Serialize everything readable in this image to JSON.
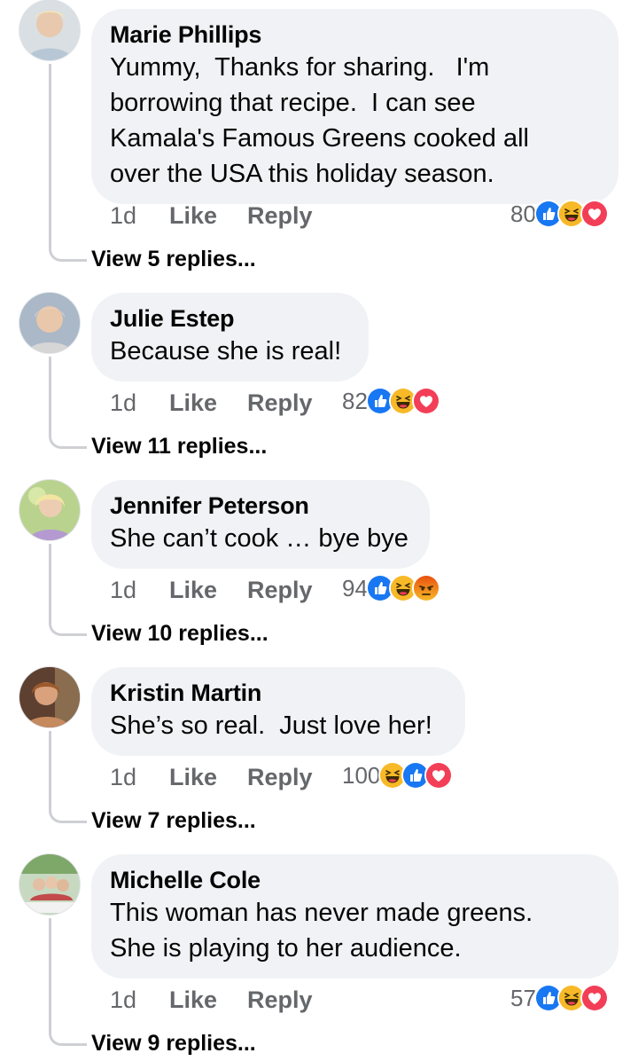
{
  "actions": {
    "like_label": "Like",
    "reply_label": "Reply"
  },
  "comments": [
    {
      "author": "Marie Phillips",
      "text": "Yummy,  Thanks for sharing.   I'm\nborrowing that recipe.  I can see\nKamala's Famous Greens cooked all\nover the USA this holiday season.",
      "time": "1d",
      "reaction_count": "80",
      "reactions": [
        "like-icon",
        "haha-icon",
        "love-icon"
      ],
      "view_replies": "View 5 replies..."
    },
    {
      "author": "Julie Estep",
      "text": "Because she is real!",
      "time": "1d",
      "reaction_count": "82",
      "reactions": [
        "like-icon",
        "haha-icon",
        "love-icon"
      ],
      "view_replies": "View 11 replies..."
    },
    {
      "author": "Jennifer Peterson",
      "text": "She can’t cook … bye bye",
      "time": "1d",
      "reaction_count": "94",
      "reactions": [
        "like-icon",
        "haha-icon",
        "angry-icon"
      ],
      "view_replies": "View 10 replies..."
    },
    {
      "author": "Kristin Martin",
      "text": "She’s so real.  Just love her!",
      "time": "1d",
      "reaction_count": "100",
      "reactions": [
        "haha-icon",
        "like-icon",
        "love-icon"
      ],
      "view_replies": "View 7 replies..."
    },
    {
      "author": "Michelle Cole",
      "text": "This woman has never made greens.\nShe is playing to her audience.",
      "time": "1d",
      "reaction_count": "57",
      "reactions": [
        "like-icon",
        "haha-icon",
        "love-icon"
      ],
      "view_replies": "View 9 replies..."
    }
  ],
  "colors": {
    "like": "#1877f2",
    "love": "#f33e58",
    "haha": "#f7b928",
    "angry": "#e9710f"
  }
}
